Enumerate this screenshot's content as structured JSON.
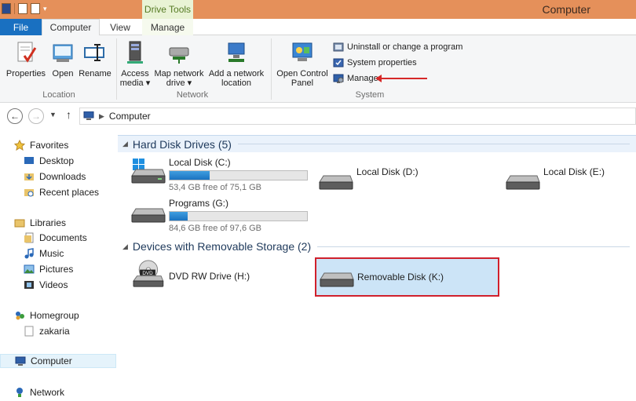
{
  "window": {
    "title": "Computer",
    "contextual_tab": "Drive Tools"
  },
  "tabs": [
    {
      "label": "File"
    },
    {
      "label": "Computer"
    },
    {
      "label": "View"
    },
    {
      "label": "Manage"
    }
  ],
  "ribbon": {
    "location": {
      "label": "Location",
      "buttons": [
        {
          "label": "Properties"
        },
        {
          "label": "Open"
        },
        {
          "label": "Rename"
        }
      ]
    },
    "network": {
      "label": "Network",
      "buttons": [
        {
          "line1": "Access",
          "line2": "media ▾"
        },
        {
          "line1": "Map network",
          "line2": "drive ▾"
        },
        {
          "line1": "Add a network",
          "line2": "location"
        }
      ]
    },
    "system": {
      "label": "System",
      "open_cp": {
        "line1": "Open Control",
        "line2": "Panel"
      },
      "items": [
        {
          "label": "Uninstall or change a program"
        },
        {
          "label": "System properties"
        },
        {
          "label": "Manage"
        }
      ]
    }
  },
  "address": {
    "path": "Computer"
  },
  "nav": {
    "favorites": "Favorites",
    "desktop": "Desktop",
    "downloads": "Downloads",
    "recent": "Recent places",
    "libraries": "Libraries",
    "documents": "Documents",
    "music": "Music",
    "pictures": "Pictures",
    "videos": "Videos",
    "homegroup": "Homegroup",
    "user": "zakaria",
    "computer": "Computer",
    "network": "Network"
  },
  "groups": {
    "hdd": "Hard Disk Drives (5)",
    "removable": "Devices with Removable Storage (2)"
  },
  "drives": {
    "c": {
      "name": "Local Disk (C:)",
      "free": "53,4 GB free of 75,1 GB",
      "used_fraction": 0.29
    },
    "d": {
      "name": "Local Disk (D:)"
    },
    "e": {
      "name": "Local Disk (E:)"
    },
    "g": {
      "name": "Programs (G:)",
      "free": "84,6 GB free of 97,6 GB",
      "used_fraction": 0.13
    },
    "h": {
      "name": "DVD RW Drive (H:)"
    },
    "k": {
      "name": "Removable Disk (K:)"
    }
  }
}
